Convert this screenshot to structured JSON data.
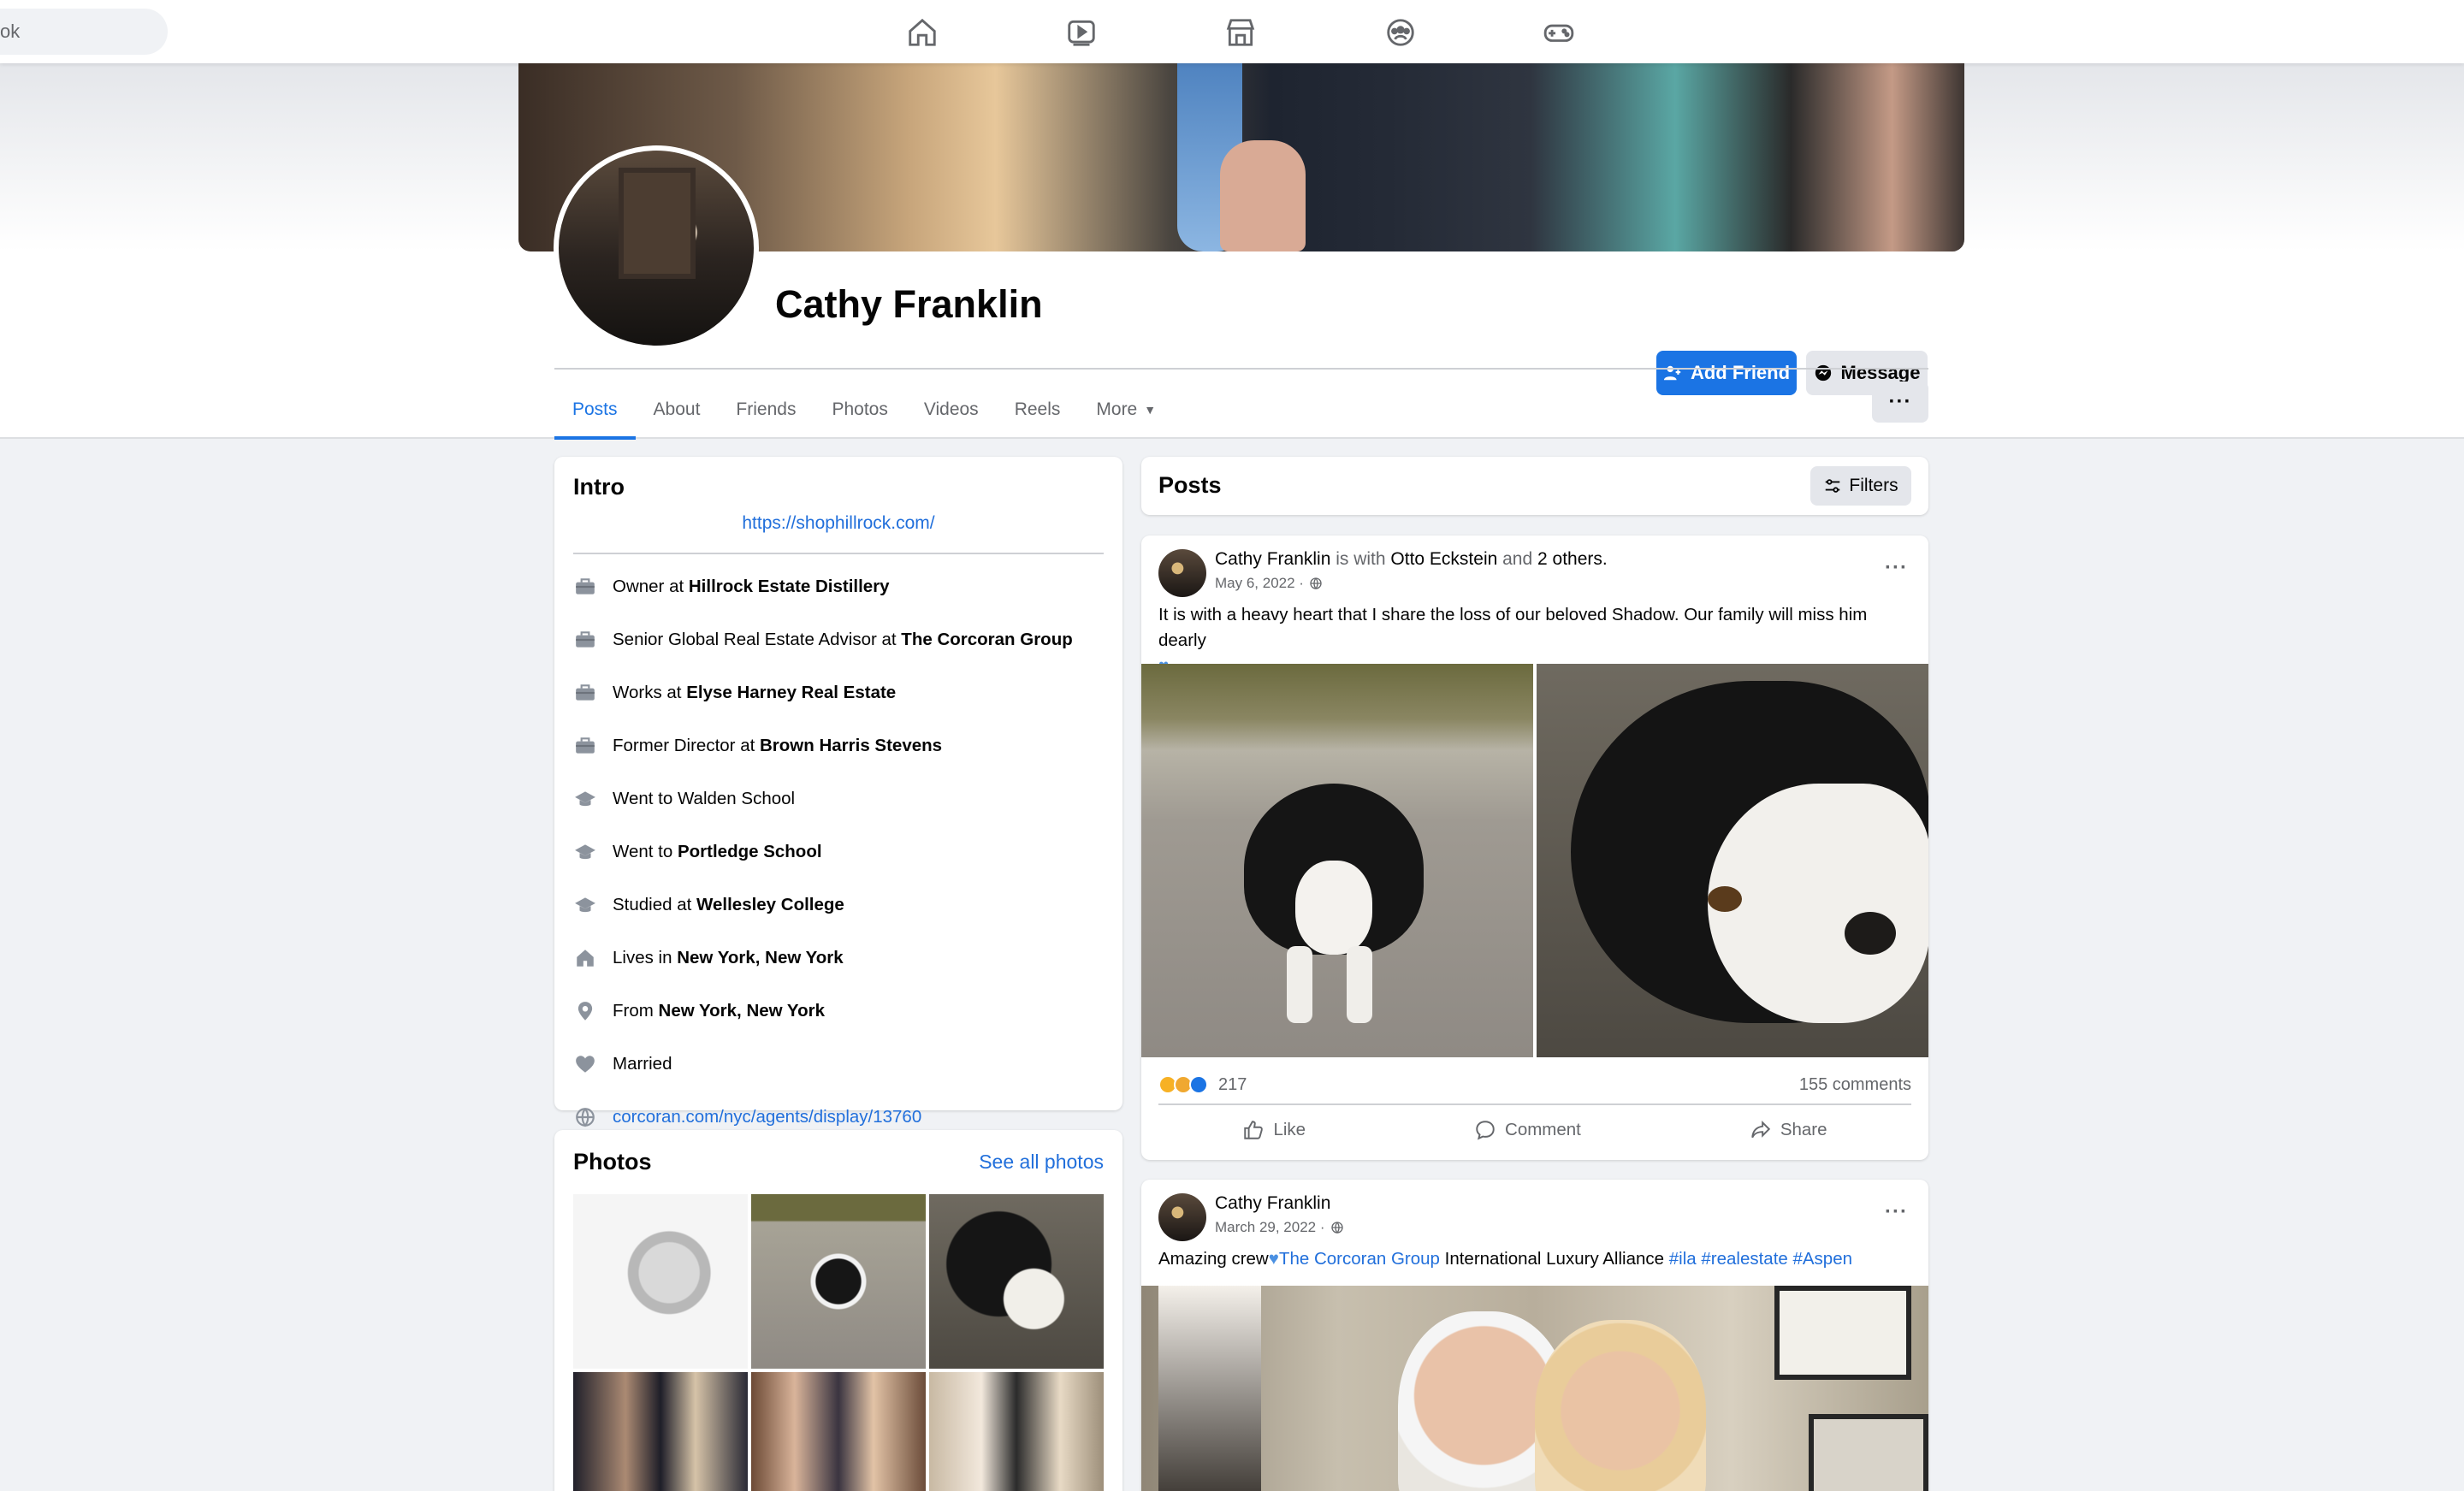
{
  "topbar": {
    "search_text": "ok",
    "nav": [
      "home-icon",
      "watch-icon",
      "marketplace-icon",
      "groups-icon",
      "gaming-icon"
    ]
  },
  "profile": {
    "name": "Cathy Franklin",
    "add_friend_label": "Add Friend",
    "message_label": "Message",
    "more_dots": "···"
  },
  "tabs": [
    {
      "label": "Posts",
      "active": true
    },
    {
      "label": "About"
    },
    {
      "label": "Friends"
    },
    {
      "label": "Photos"
    },
    {
      "label": "Videos"
    },
    {
      "label": "Reels"
    },
    {
      "label": "More"
    }
  ],
  "intro": {
    "title": "Intro",
    "website": "https://shophillrock.com/",
    "rows": [
      {
        "icon": "work-icon",
        "prefix": "Owner at ",
        "bold": "Hillrock Estate Distillery"
      },
      {
        "icon": "work-icon",
        "prefix": "Senior Global Real Estate Advisor at ",
        "bold": "The Corcoran Group"
      },
      {
        "icon": "work-icon",
        "prefix": "Works at ",
        "bold": "Elyse Harney Real Estate"
      },
      {
        "icon": "work-icon",
        "prefix": "Former Director at ",
        "bold": "Brown Harris Stevens"
      },
      {
        "icon": "education-icon",
        "prefix": "Went to Walden School",
        "bold": ""
      },
      {
        "icon": "education-icon",
        "prefix": "Went to ",
        "bold": "Portledge School"
      },
      {
        "icon": "education-icon",
        "prefix": "Studied at ",
        "bold": "Wellesley College"
      },
      {
        "icon": "home-icon",
        "prefix": "Lives in ",
        "bold": "New York, New York"
      },
      {
        "icon": "location-pin-icon",
        "prefix": "From ",
        "bold": "New York, New York"
      },
      {
        "icon": "heart-icon",
        "prefix": "Married",
        "bold": ""
      },
      {
        "icon": "globe-icon",
        "prefix": "",
        "bold": "",
        "link": "corcoran.com/nyc/agents/display/13760"
      }
    ]
  },
  "photos": {
    "title": "Photos",
    "see_all": "See all photos"
  },
  "posts_header": {
    "title": "Posts",
    "filters": "Filters"
  },
  "post1": {
    "author": "Cathy Franklin",
    "with_text": " is with ",
    "tagged": "Otto Eckstein",
    "and_text": " and ",
    "others": "2 others",
    "period": ".",
    "date": "May 6, 2022 ·",
    "text": "It is with a heavy heart that I share the loss of our beloved Shadow. Our family will miss him dearly",
    "reactions_count": "217",
    "comments": "155 comments",
    "like": "Like",
    "comment": "Comment",
    "share": "Share"
  },
  "post2": {
    "author": "Cathy Franklin",
    "date": "March 29, 2022 ·",
    "text_prefix": "Amazing crew",
    "link_group": "The Corcoran Group",
    "text_middle": " International Luxury Alliance ",
    "hashtags": "#ila #realestate #Aspen"
  },
  "colors": {
    "accent": "#1b74e4",
    "link": "#216fdb",
    "background": "#f0f2f5",
    "muted_text": "#65676b"
  }
}
